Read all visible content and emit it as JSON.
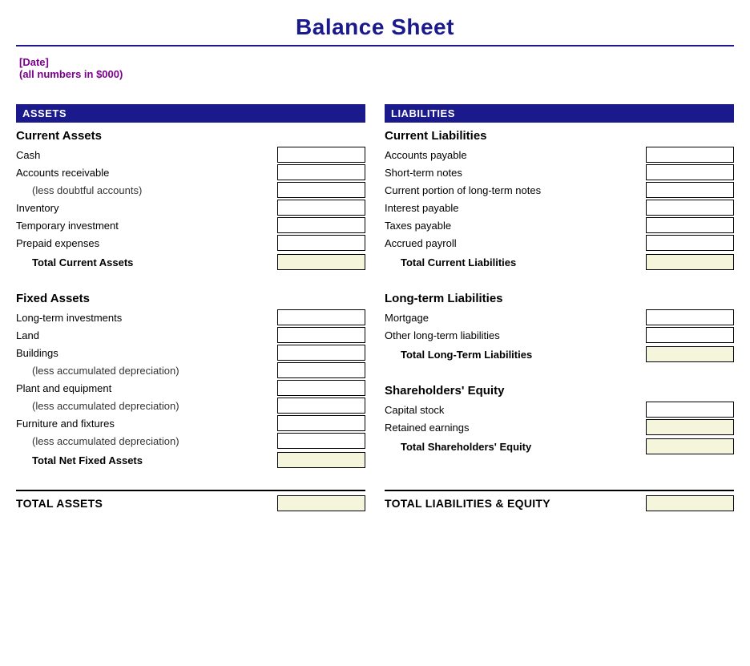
{
  "title": "Balance Sheet",
  "meta": {
    "date_label": "[Date]",
    "unit_label": "(all numbers in $000)"
  },
  "assets": {
    "header": "ASSETS",
    "current": {
      "title": "Current Assets",
      "rows": [
        {
          "label": "Cash",
          "indent": false
        },
        {
          "label": "Accounts receivable",
          "indent": false
        },
        {
          "label": "(less doubtful accounts)",
          "indent": true
        },
        {
          "label": "Inventory",
          "indent": false
        },
        {
          "label": "Temporary investment",
          "indent": false
        },
        {
          "label": "Prepaid expenses",
          "indent": false
        }
      ],
      "total_label": "Total Current Assets"
    },
    "fixed": {
      "title": "Fixed Assets",
      "rows": [
        {
          "label": "Long-term investments",
          "indent": false
        },
        {
          "label": "Land",
          "indent": false
        },
        {
          "label": "Buildings",
          "indent": false
        },
        {
          "label": "(less accumulated depreciation)",
          "indent": true
        },
        {
          "label": "Plant and equipment",
          "indent": false
        },
        {
          "label": "(less accumulated depreciation)",
          "indent": true
        },
        {
          "label": "Furniture and fixtures",
          "indent": false
        },
        {
          "label": "(less accumulated depreciation)",
          "indent": true
        }
      ],
      "total_label": "Total Net Fixed Assets"
    }
  },
  "liabilities": {
    "header": "LIABILITIES",
    "current": {
      "title": "Current Liabilities",
      "rows": [
        {
          "label": "Accounts payable",
          "indent": false
        },
        {
          "label": "Short-term notes",
          "indent": false
        },
        {
          "label": "Current portion of long-term notes",
          "indent": false
        },
        {
          "label": "Interest payable",
          "indent": false
        },
        {
          "label": "Taxes payable",
          "indent": false
        },
        {
          "label": "Accrued payroll",
          "indent": false
        }
      ],
      "total_label": "Total Current Liabilities"
    },
    "longterm": {
      "title": "Long-term Liabilities",
      "rows": [
        {
          "label": "Mortgage",
          "indent": false
        },
        {
          "label": "Other long-term liabilities",
          "indent": false
        }
      ],
      "total_label": "Total Long-Term Liabilities"
    },
    "equity": {
      "title": "Shareholders' Equity",
      "rows": [
        {
          "label": "Capital stock",
          "indent": false
        },
        {
          "label": "Retained earnings",
          "indent": false
        }
      ],
      "total_label": "Total Shareholders' Equity"
    }
  },
  "totals": {
    "assets_label": "TOTAL ASSETS",
    "liabilities_label": "TOTAL LIABILITIES & EQUITY"
  }
}
